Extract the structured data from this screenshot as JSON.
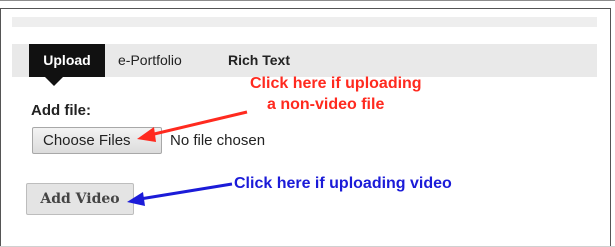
{
  "tabs": [
    {
      "label": "Upload",
      "active": true
    },
    {
      "label": "e-Portfolio",
      "active": false
    },
    {
      "label": "Rich Text",
      "active": false
    }
  ],
  "upload_form": {
    "add_file_label": "Add file:",
    "choose_files_label": "Choose Files",
    "file_status": "No file chosen",
    "add_video_label": "Add Video"
  },
  "annotations": {
    "non_video_line1": "Click here if uploading",
    "non_video_line2": "a non-video file",
    "video": "Click here if uploading video",
    "non_video_color": "#ff2a1f",
    "video_color": "#1b1bd8"
  }
}
